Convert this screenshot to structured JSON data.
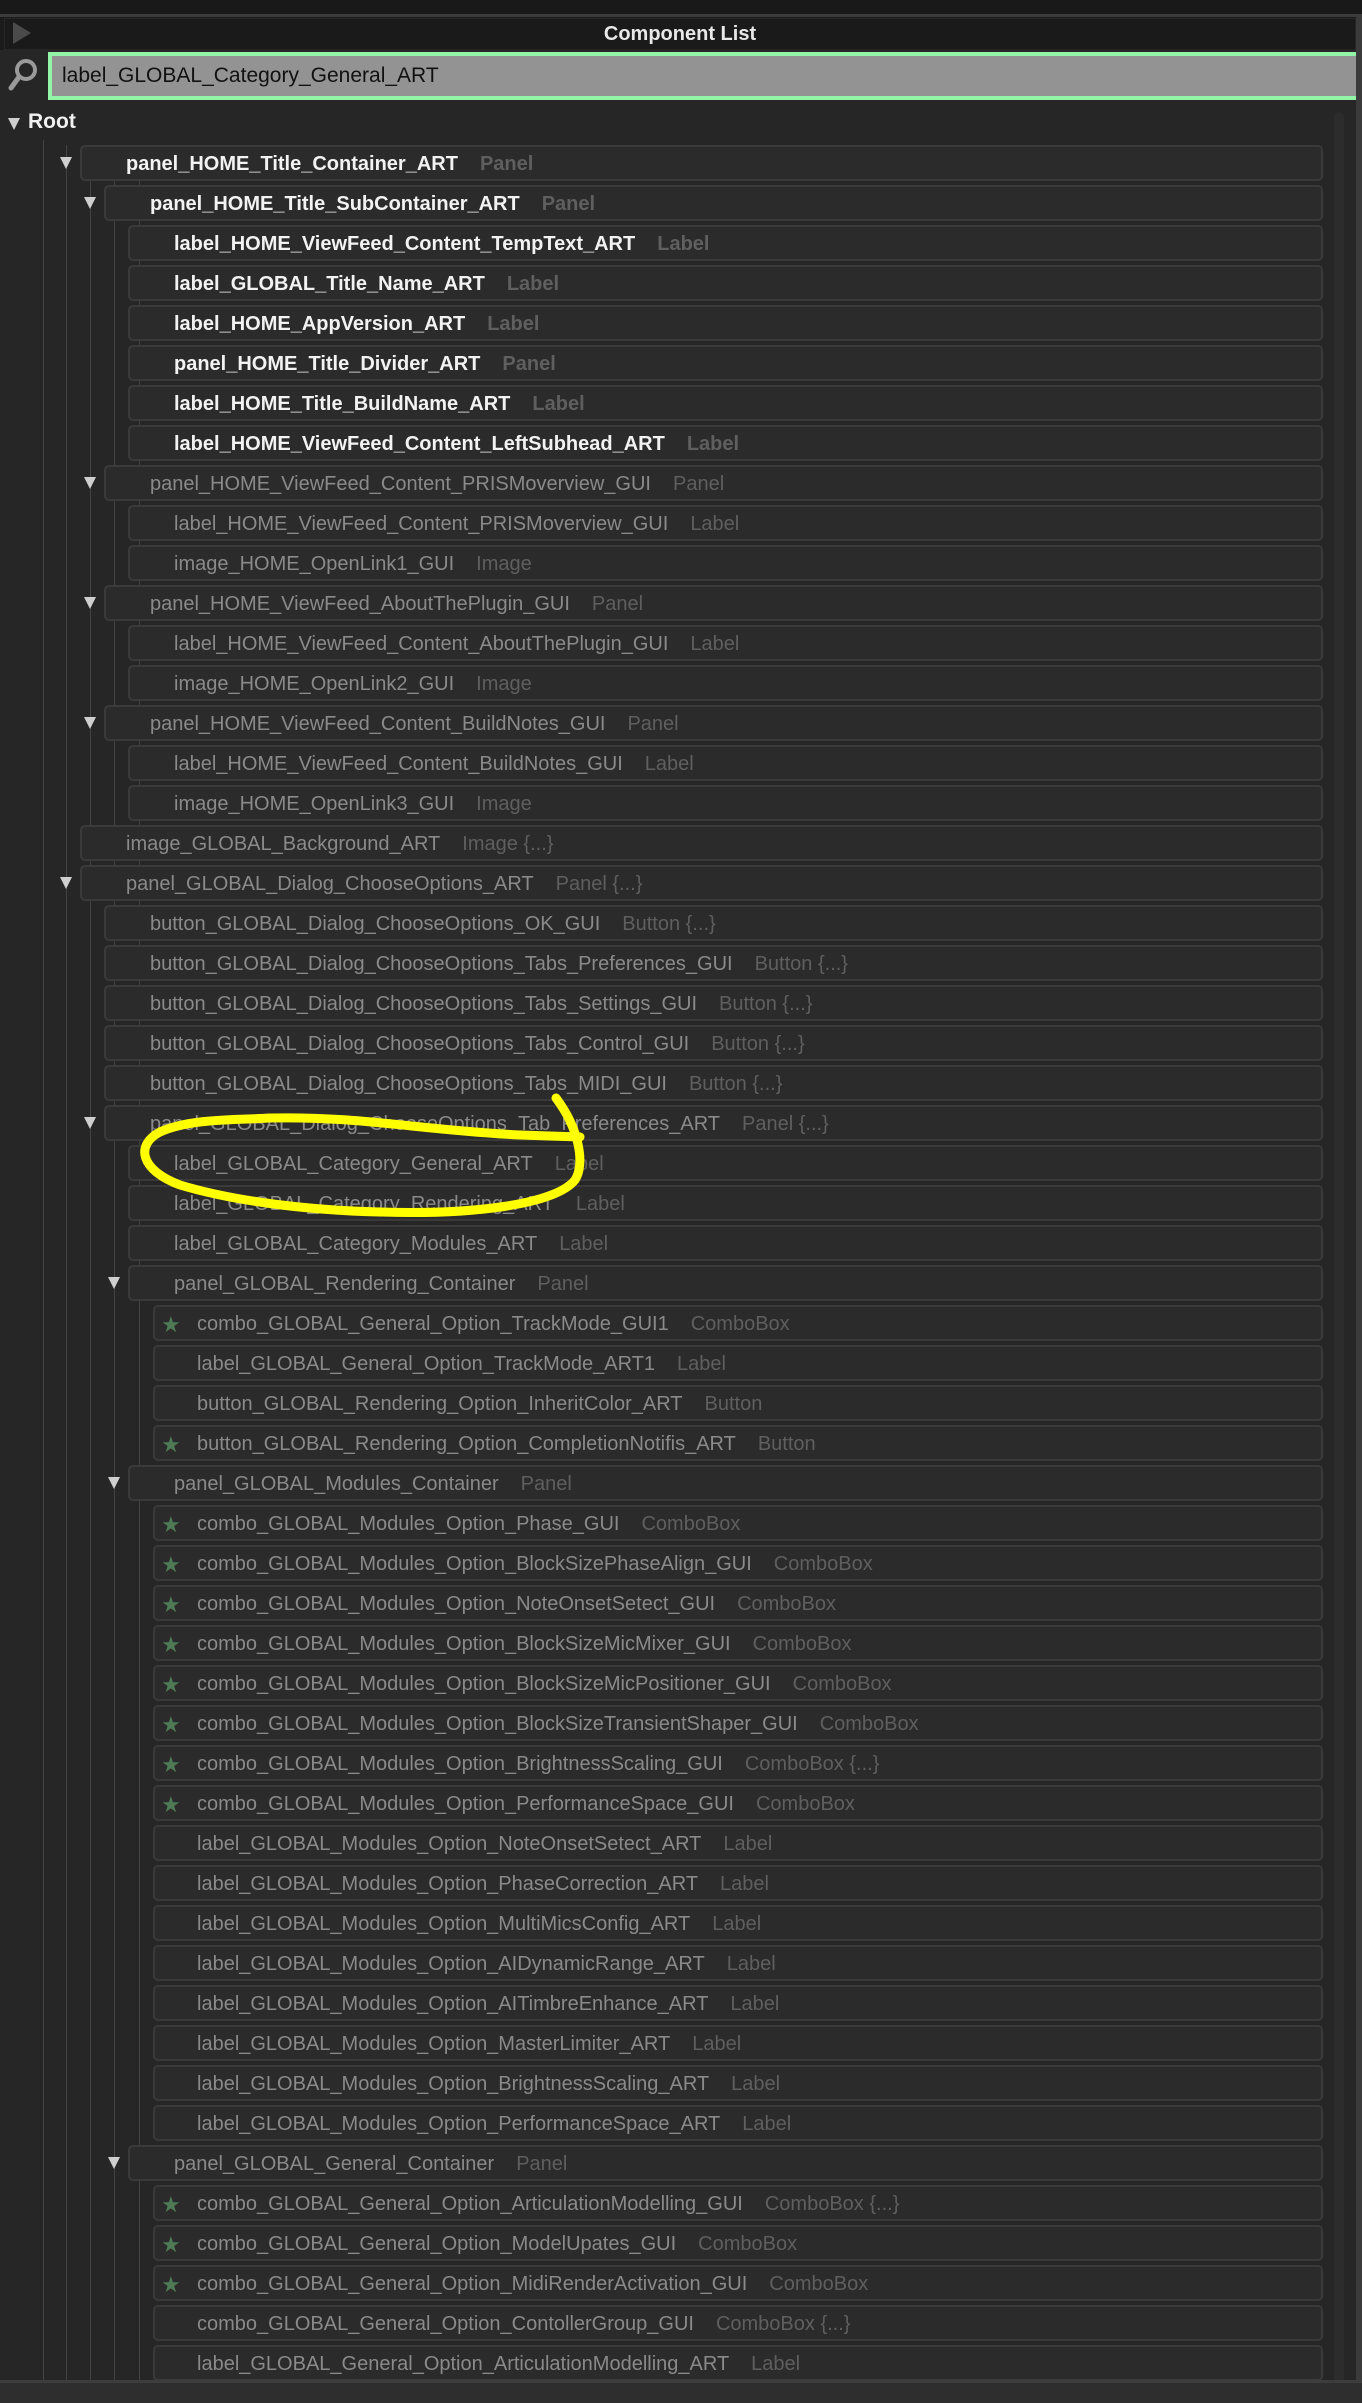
{
  "header": {
    "title": "Component List"
  },
  "search": {
    "value": "label_GLOBAL_Category_General_ART"
  },
  "tree": {
    "root_label": "Root",
    "rows": [
      {
        "name": "panel_HOME_Title_Container_ART",
        "type": "Panel",
        "level": 1,
        "expanded": true,
        "bright": true
      },
      {
        "name": "panel_HOME_Title_SubContainer_ART",
        "type": "Panel",
        "level": 2,
        "expanded": true,
        "bright": true
      },
      {
        "name": "label_HOME_ViewFeed_Content_TempText_ART",
        "type": "Label",
        "level": 3,
        "bright": true
      },
      {
        "name": "label_GLOBAL_Title_Name_ART",
        "type": "Label",
        "level": 3,
        "bright": true
      },
      {
        "name": "label_HOME_AppVersion_ART",
        "type": "Label",
        "level": 3,
        "bright": true
      },
      {
        "name": "panel_HOME_Title_Divider_ART",
        "type": "Panel",
        "level": 3,
        "bright": true
      },
      {
        "name": "label_HOME_Title_BuildName_ART",
        "type": "Label",
        "level": 3,
        "bright": true
      },
      {
        "name": "label_HOME_ViewFeed_Content_LeftSubhead_ART",
        "type": "Label",
        "level": 3,
        "bright": true
      },
      {
        "name": "panel_HOME_ViewFeed_Content_PRISMoverview_GUI",
        "type": "Panel",
        "level": 2,
        "expanded": true
      },
      {
        "name": "label_HOME_ViewFeed_Content_PRISMoverview_GUI",
        "type": "Label",
        "level": 3
      },
      {
        "name": "image_HOME_OpenLink1_GUI",
        "type": "Image",
        "level": 3
      },
      {
        "name": "panel_HOME_ViewFeed_AboutThePlugin_GUI",
        "type": "Panel",
        "level": 2,
        "expanded": true
      },
      {
        "name": "label_HOME_ViewFeed_Content_AboutThePlugin_GUI",
        "type": "Label",
        "level": 3
      },
      {
        "name": "image_HOME_OpenLink2_GUI",
        "type": "Image",
        "level": 3
      },
      {
        "name": "panel_HOME_ViewFeed_Content_BuildNotes_GUI",
        "type": "Panel",
        "level": 2,
        "expanded": true
      },
      {
        "name": "label_HOME_ViewFeed_Content_BuildNotes_GUI",
        "type": "Label",
        "level": 3
      },
      {
        "name": "image_HOME_OpenLink3_GUI",
        "type": "Image",
        "level": 3
      },
      {
        "name": "image_GLOBAL_Background_ART",
        "type": "Image {...}",
        "level": 1
      },
      {
        "name": "panel_GLOBAL_Dialog_ChooseOptions_ART",
        "type": "Panel {...}",
        "level": 1,
        "expanded": true
      },
      {
        "name": "button_GLOBAL_Dialog_ChooseOptions_OK_GUI",
        "type": "Button {...}",
        "level": 2
      },
      {
        "name": "button_GLOBAL_Dialog_ChooseOptions_Tabs_Preferences_GUI",
        "type": "Button {...}",
        "level": 2
      },
      {
        "name": "button_GLOBAL_Dialog_ChooseOptions_Tabs_Settings_GUI",
        "type": "Button {...}",
        "level": 2
      },
      {
        "name": "button_GLOBAL_Dialog_ChooseOptions_Tabs_Control_GUI",
        "type": "Button {...}",
        "level": 2
      },
      {
        "name": "button_GLOBAL_Dialog_ChooseOptions_Tabs_MIDI_GUI",
        "type": "Button {...}",
        "level": 2
      },
      {
        "name": "panel_GLOBAL_Dialog_ChooseOptions_Tab_Preferences_ART",
        "type": "Panel {...}",
        "level": 2,
        "expanded": true
      },
      {
        "name": "label_GLOBAL_Category_General_ART",
        "type": "Label",
        "level": 3
      },
      {
        "name": "label_GLOBAL_Category_Rendering_ART",
        "type": "Label",
        "level": 3
      },
      {
        "name": "label_GLOBAL_Category_Modules_ART",
        "type": "Label",
        "level": 3
      },
      {
        "name": "panel_GLOBAL_Rendering_Container",
        "type": "Panel",
        "level": 3,
        "expanded": true
      },
      {
        "name": "combo_GLOBAL_General_Option_TrackMode_GUI1",
        "type": "ComboBox",
        "level": 4,
        "star": true
      },
      {
        "name": "label_GLOBAL_General_Option_TrackMode_ART1",
        "type": "Label",
        "level": 4
      },
      {
        "name": "button_GLOBAL_Rendering_Option_InheritColor_ART",
        "type": "Button",
        "level": 4
      },
      {
        "name": "button_GLOBAL_Rendering_Option_CompletionNotifis_ART",
        "type": "Button",
        "level": 4,
        "star": true
      },
      {
        "name": "panel_GLOBAL_Modules_Container",
        "type": "Panel",
        "level": 3,
        "expanded": true
      },
      {
        "name": "combo_GLOBAL_Modules_Option_Phase_GUI",
        "type": "ComboBox",
        "level": 4,
        "star": true
      },
      {
        "name": "combo_GLOBAL_Modules_Option_BlockSizePhaseAlign_GUI",
        "type": "ComboBox",
        "level": 4,
        "star": true
      },
      {
        "name": "combo_GLOBAL_Modules_Option_NoteOnsetSetect_GUI",
        "type": "ComboBox",
        "level": 4,
        "star": true
      },
      {
        "name": "combo_GLOBAL_Modules_Option_BlockSizeMicMixer_GUI",
        "type": "ComboBox",
        "level": 4,
        "star": true
      },
      {
        "name": "combo_GLOBAL_Modules_Option_BlockSizeMicPositioner_GUI",
        "type": "ComboBox",
        "level": 4,
        "star": true
      },
      {
        "name": "combo_GLOBAL_Modules_Option_BlockSizeTransientShaper_GUI",
        "type": "ComboBox",
        "level": 4,
        "star": true
      },
      {
        "name": "combo_GLOBAL_Modules_Option_BrightnessScaling_GUI",
        "type": "ComboBox {...}",
        "level": 4,
        "star": true
      },
      {
        "name": "combo_GLOBAL_Modules_Option_PerformanceSpace_GUI",
        "type": "ComboBox",
        "level": 4,
        "star": true
      },
      {
        "name": "label_GLOBAL_Modules_Option_NoteOnsetSetect_ART",
        "type": "Label",
        "level": 4
      },
      {
        "name": "label_GLOBAL_Modules_Option_PhaseCorrection_ART",
        "type": "Label",
        "level": 4
      },
      {
        "name": "label_GLOBAL_Modules_Option_MultiMicsConfig_ART",
        "type": "Label",
        "level": 4
      },
      {
        "name": "label_GLOBAL_Modules_Option_AIDynamicRange_ART",
        "type": "Label",
        "level": 4
      },
      {
        "name": "label_GLOBAL_Modules_Option_AITimbreEnhance_ART",
        "type": "Label",
        "level": 4
      },
      {
        "name": "label_GLOBAL_Modules_Option_MasterLimiter_ART",
        "type": "Label",
        "level": 4
      },
      {
        "name": "label_GLOBAL_Modules_Option_BrightnessScaling_ART",
        "type": "Label",
        "level": 4
      },
      {
        "name": "label_GLOBAL_Modules_Option_PerformanceSpace_ART",
        "type": "Label",
        "level": 4
      },
      {
        "name": "panel_GLOBAL_General_Container",
        "type": "Panel",
        "level": 3,
        "expanded": true
      },
      {
        "name": "combo_GLOBAL_General_Option_ArticulationModelling_GUI",
        "type": "ComboBox {...}",
        "level": 4,
        "star": true
      },
      {
        "name": "combo_GLOBAL_General_Option_ModelUpates_GUI",
        "type": "ComboBox",
        "level": 4,
        "star": true
      },
      {
        "name": "combo_GLOBAL_General_Option_MidiRenderActivation_GUI",
        "type": "ComboBox",
        "level": 4,
        "star": true
      },
      {
        "name": "combo_GLOBAL_General_Option_ContollerGroup_GUI",
        "type": "ComboBox {...}",
        "level": 4
      },
      {
        "name": "label_GLOBAL_General_Option_ArticulationModelling_ART",
        "type": "Label",
        "level": 4
      }
    ]
  },
  "colors": {
    "search_border": "#93f5a8",
    "star": "#4e7a55",
    "annotation": "#ffff00",
    "background": "#262626"
  },
  "icons": {
    "play": "play-triangle-icon",
    "search": "magnifier-icon",
    "expand": "triangle-down-icon",
    "star": "star-icon"
  }
}
